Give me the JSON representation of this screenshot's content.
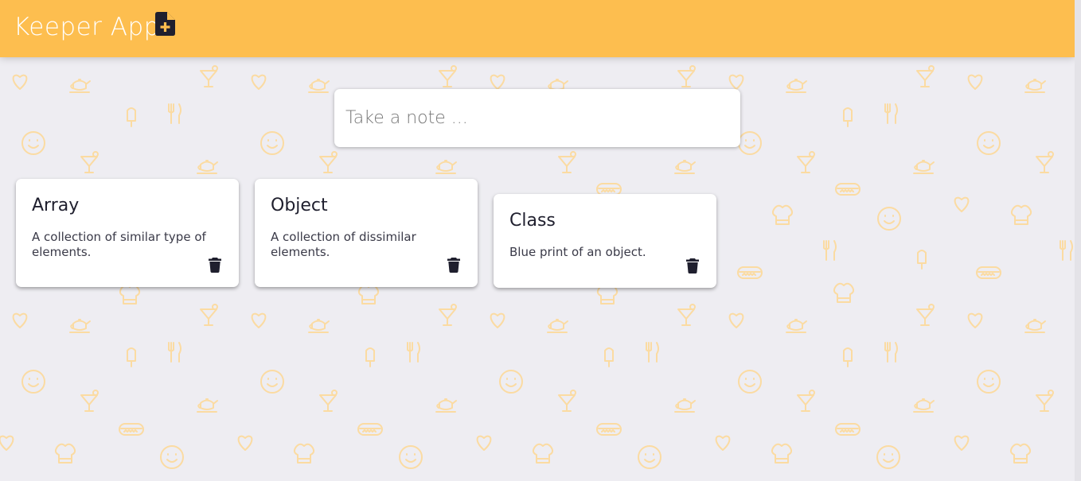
{
  "header": {
    "title": "Keeper App",
    "icon": "note-add-icon",
    "color": "#fdbe4f"
  },
  "create_area": {
    "placeholder": "Take a note ..."
  },
  "notes": [
    {
      "title": "Array",
      "content": "A collection of similar type of elements.",
      "delete_icon": "trash-icon"
    },
    {
      "title": "Object",
      "content": "A collection of dissimilar elements.",
      "delete_icon": "trash-icon"
    },
    {
      "title": "Class",
      "content": "Blue print of an object.",
      "delete_icon": "trash-icon"
    }
  ],
  "colors": {
    "accent": "#fdbe4f",
    "background": "#eeedf2",
    "text": "#1f1f2e"
  }
}
